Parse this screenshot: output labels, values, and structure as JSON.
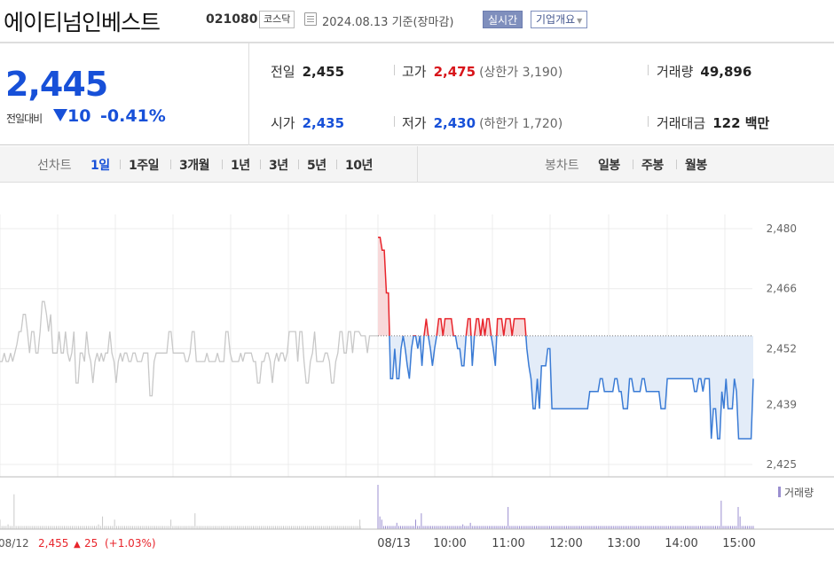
{
  "header": {
    "title": "에이티넘인베스트",
    "code": "021080",
    "market": "코스닥",
    "date_text": "2024.08.13 기준(장마감)",
    "realtime_label": "실시간",
    "company_label": "기업개요"
  },
  "summary": {
    "current_price": "2,445",
    "change_label": "전일대비",
    "change_value": "10",
    "change_pct": "-0.41%",
    "prev_close_label": "전일",
    "prev_close": "2,455",
    "high_label": "고가",
    "high": "2,475",
    "upper_limit_label": "상한가",
    "upper_limit": "3,190",
    "volume_label": "거래량",
    "volume": "49,896",
    "open_label": "시가",
    "open": "2,435",
    "low_label": "저가",
    "low": "2,430",
    "lower_limit_label": "하한가",
    "lower_limit": "1,720",
    "amount_label": "거래대금",
    "amount": "122 백만"
  },
  "tabs": {
    "line_label": "선차트",
    "line_tabs": [
      "1일",
      "1주일",
      "3개월",
      "1년",
      "3년",
      "5년",
      "10년"
    ],
    "active": "1일",
    "candle_label": "봉차트",
    "candle_tabs": [
      "일봉",
      "주봉",
      "월봉"
    ]
  },
  "colors": {
    "up": "#e8242b",
    "down": "#3a7bd5",
    "accent": "#1750d8",
    "prev_line": "#c8c8c8"
  },
  "chart_data": {
    "type": "line",
    "y_ticks": [
      "2,480",
      "2,466",
      "2,452",
      "2,439",
      "2,425"
    ],
    "ylim": [
      2425,
      2480
    ],
    "x_labels": [
      "08/13",
      "10:00",
      "11:00",
      "12:00",
      "13:00",
      "14:00",
      "15:00"
    ],
    "prev_day_label": "08/12",
    "prev_day_close": "2,455",
    "prev_day_change": "25",
    "prev_day_change_pct": "(+1.03%)",
    "volume_legend": "거래량",
    "reference_price": 2455,
    "prev_day_series": [
      2449,
      2449,
      2451,
      2449,
      2449,
      2451,
      2449,
      2451,
      2453,
      2456,
      2456,
      2460,
      2460,
      2456,
      2451,
      2456,
      2456,
      2451,
      2451,
      2456,
      2463,
      2463,
      2460,
      2456,
      2460,
      2451,
      2451,
      2451,
      2456,
      2451,
      2451,
      2456,
      2451,
      2449,
      2451,
      2456,
      2444,
      2444,
      2451,
      2451,
      2449,
      2456,
      2451,
      2449,
      2444,
      2449,
      2451,
      2449,
      2451,
      2449,
      2451,
      2451,
      2456,
      2451,
      2449,
      2444,
      2449,
      2451,
      2449,
      2451,
      2451,
      2449,
      2449,
      2451,
      2451,
      2449,
      2449,
      2449,
      2451,
      2451,
      2451,
      2441,
      2441,
      2449,
      2451,
      2451,
      2451,
      2451,
      2451,
      2451,
      2456,
      2456,
      2451,
      2451,
      2451,
      2451,
      2451,
      2451,
      2449,
      2449,
      2451,
      2456,
      2456,
      2449,
      2449,
      2449,
      2449,
      2449,
      2451,
      2449,
      2449,
      2449,
      2449,
      2451,
      2449,
      2449,
      2449,
      2456,
      2456,
      2451,
      2449,
      2449,
      2449,
      2449,
      2451,
      2449,
      2451,
      2451,
      2451,
      2451,
      2449,
      2449,
      2444,
      2444,
      2449,
      2449,
      2451,
      2451,
      2449,
      2444,
      2449,
      2451,
      2449,
      2451,
      2451,
      2449,
      2451,
      2456,
      2456,
      2456,
      2456,
      2449,
      2456,
      2456,
      2449,
      2444,
      2444,
      2449,
      2451,
      2456,
      2449,
      2449,
      2449,
      2449,
      2451,
      2451,
      2449,
      2444,
      2444,
      2449,
      2451,
      2456,
      2456,
      2451,
      2451,
      2456,
      2456,
      2451,
      2456,
      2456,
      2456,
      2455,
      2455,
      2455,
      2451,
      2455,
      2455,
      2455,
      2455,
      2455
    ],
    "today_series": [
      2478,
      2478,
      2475,
      2475,
      2465,
      2465,
      2445,
      2445,
      2452,
      2445,
      2445,
      2452,
      2455,
      2452,
      2448,
      2445,
      2452,
      2455,
      2455,
      2452,
      2455,
      2448,
      2455,
      2459,
      2455,
      2452,
      2448,
      2452,
      2455,
      2459,
      2459,
      2455,
      2459,
      2459,
      2459,
      2459,
      2455,
      2455,
      2452,
      2452,
      2448,
      2448,
      2455,
      2459,
      2459,
      2448,
      2455,
      2459,
      2459,
      2455,
      2459,
      2455,
      2459,
      2459,
      2455,
      2452,
      2448,
      2459,
      2459,
      2459,
      2455,
      2459,
      2459,
      2459,
      2455,
      2459,
      2459,
      2459,
      2459,
      2459,
      2459,
      2452,
      2448,
      2445,
      2438,
      2438,
      2445,
      2438,
      2448,
      2448,
      2448,
      2452,
      2452,
      2438,
      2438,
      2438,
      2438,
      2438,
      2438,
      2438,
      2438,
      2438,
      2438,
      2438,
      2438,
      2438,
      2438,
      2438,
      2438,
      2438,
      2438,
      2442,
      2442,
      2442,
      2442,
      2442,
      2445,
      2445,
      2442,
      2442,
      2442,
      2442,
      2442,
      2445,
      2445,
      2442,
      2442,
      2438,
      2438,
      2438,
      2445,
      2445,
      2442,
      2442,
      2442,
      2442,
      2445,
      2445,
      2442,
      2442,
      2442,
      2442,
      2442,
      2442,
      2442,
      2438,
      2438,
      2438,
      2445,
      2445,
      2445,
      2445,
      2445,
      2445,
      2445,
      2445,
      2445,
      2445,
      2445,
      2445,
      2445,
      2442,
      2442,
      2445,
      2445,
      2442,
      2445,
      2445,
      2445,
      2431,
      2438,
      2438,
      2431,
      2431,
      2442,
      2438,
      2445,
      2438,
      2438,
      2438,
      2445,
      2442,
      2431,
      2431,
      2431,
      2431,
      2431,
      2431,
      2431,
      2445
    ],
    "prev_day_volume": [
      6,
      2,
      2,
      2,
      3,
      2,
      2,
      22,
      2,
      2,
      2,
      2,
      2,
      2,
      2,
      2,
      2,
      2,
      2,
      2,
      2,
      2,
      2,
      2,
      2,
      2,
      2,
      2,
      2,
      2,
      2,
      2,
      2,
      2,
      2,
      2,
      2,
      2,
      2,
      2,
      2,
      2,
      2,
      2,
      2,
      2,
      2,
      2,
      2,
      3,
      2,
      8,
      2,
      2,
      2,
      2,
      2,
      6,
      2,
      2,
      2,
      2,
      2,
      2,
      2,
      2,
      2,
      2,
      2,
      2,
      2,
      2,
      2,
      2,
      2,
      2,
      2,
      2,
      2,
      2,
      2,
      2,
      2,
      2,
      2,
      6,
      2,
      2,
      2,
      2,
      2,
      2,
      2,
      2,
      2,
      2,
      2,
      10,
      2,
      2,
      2,
      2,
      2,
      2,
      2,
      2,
      2,
      2,
      2,
      2,
      2,
      2,
      2,
      2,
      2,
      2,
      2,
      2,
      2,
      2,
      2,
      2,
      2,
      2,
      2,
      2,
      2,
      2,
      2,
      2,
      2,
      2,
      2,
      2,
      2,
      2,
      2,
      2,
      2,
      2,
      2,
      2,
      2,
      2,
      2,
      2,
      2,
      2,
      2,
      2,
      2,
      2,
      2,
      2,
      2,
      2,
      2,
      2,
      2,
      2,
      2,
      2,
      2,
      2,
      2,
      2,
      2,
      2,
      2,
      2,
      2,
      2,
      2,
      2,
      2,
      2,
      2,
      2,
      2,
      2,
      2,
      2,
      2,
      2,
      2,
      2,
      6,
      2,
      2
    ],
    "today_volume": [
      28,
      8,
      6,
      2,
      2,
      2,
      2,
      2,
      2,
      2,
      4,
      2,
      2,
      2,
      2,
      2,
      2,
      2,
      2,
      2,
      6,
      2,
      2,
      10,
      2,
      2,
      2,
      2,
      2,
      2,
      2,
      2,
      2,
      2,
      2,
      2,
      2,
      2,
      2,
      2,
      2,
      2,
      2,
      2,
      2,
      3,
      2,
      2,
      2,
      4,
      2,
      2,
      2,
      2,
      2,
      2,
      2,
      2,
      2,
      2,
      2,
      2,
      2,
      2,
      2,
      2,
      2,
      2,
      2,
      14,
      2,
      2,
      2,
      2,
      2,
      2,
      2,
      2,
      2,
      2,
      2,
      2,
      2,
      2,
      2,
      2,
      2,
      2,
      2,
      2,
      2,
      2,
      2,
      2,
      2,
      2,
      2,
      2,
      2,
      2,
      2,
      2,
      2,
      2,
      2,
      2,
      2,
      2,
      2,
      2,
      2,
      2,
      2,
      2,
      2,
      2,
      2,
      2,
      2,
      2,
      2,
      2,
      2,
      2,
      2,
      2,
      2,
      2,
      2,
      2,
      2,
      2,
      2,
      2,
      2,
      2,
      2,
      2,
      2,
      2,
      2,
      2,
      2,
      2,
      2,
      2,
      2,
      2,
      2,
      2,
      2,
      2,
      2,
      2,
      2,
      2,
      2,
      2,
      2,
      2,
      2,
      2,
      2,
      2,
      2,
      2,
      2,
      2,
      2,
      2,
      2,
      2,
      2,
      2,
      2,
      2,
      2,
      2,
      2,
      2,
      2,
      2,
      18,
      2,
      2,
      2,
      2,
      2,
      2,
      2,
      2,
      14,
      8,
      2,
      2,
      2,
      2,
      2,
      2,
      2
    ]
  }
}
